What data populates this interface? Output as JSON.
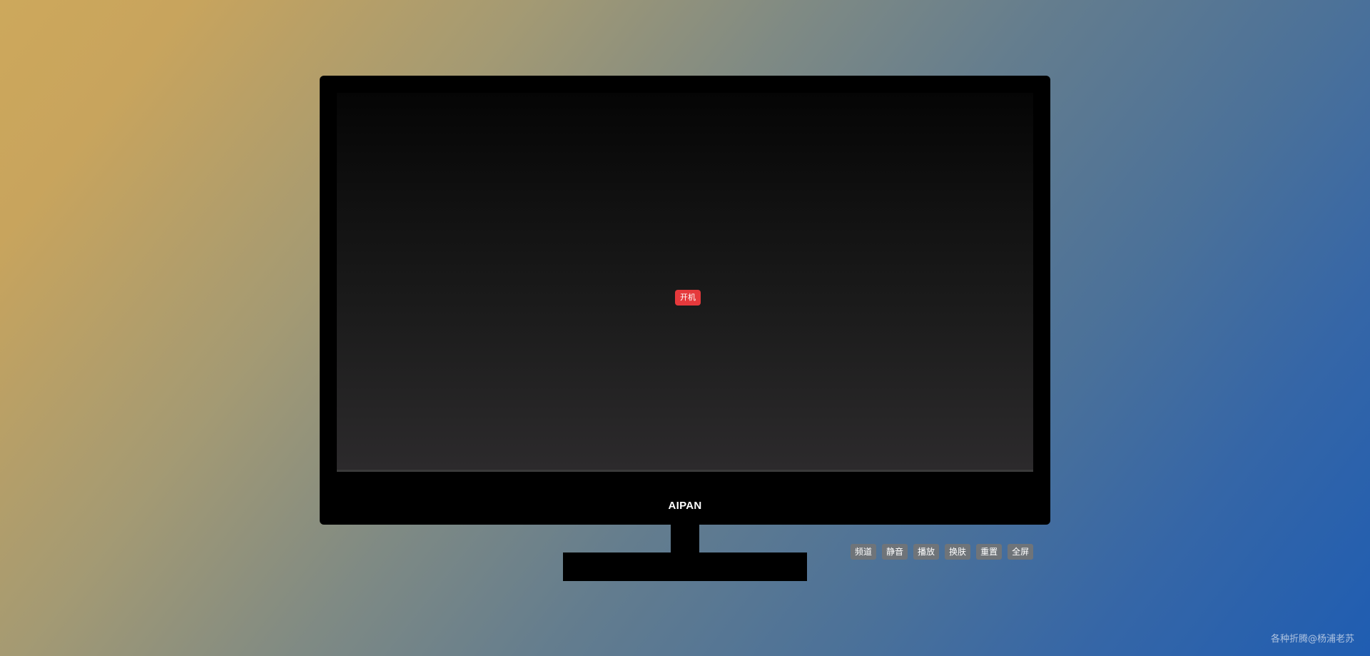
{
  "tv": {
    "power_label": "开机",
    "brand": "AIPAN"
  },
  "controls": [
    {
      "label": "频道"
    },
    {
      "label": "静音"
    },
    {
      "label": "播放"
    },
    {
      "label": "换肤"
    },
    {
      "label": "重置"
    },
    {
      "label": "全屏"
    }
  ],
  "footer": {
    "credit": "各种折腾@杨浦老苏"
  },
  "colors": {
    "power_button": "#e5393c",
    "control_button": "#6f7479",
    "tv_body": "#000000",
    "background_start": "#cda85c",
    "background_end": "#1f5db2"
  }
}
